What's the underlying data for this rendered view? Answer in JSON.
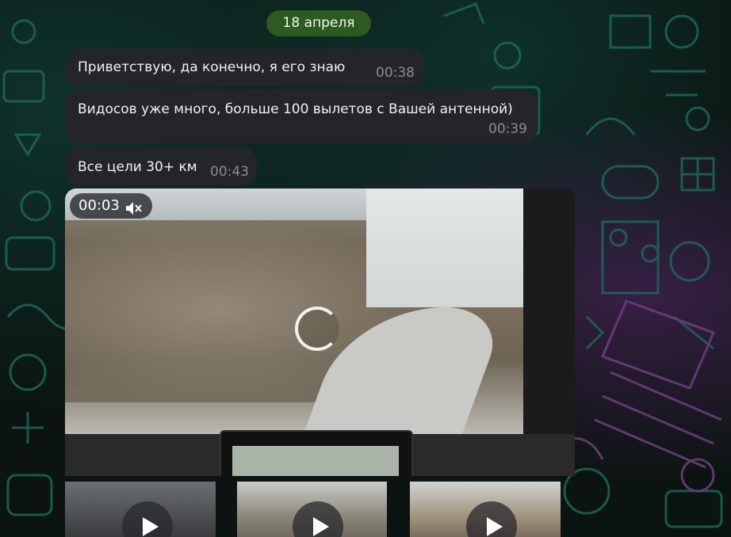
{
  "chat": {
    "date_badge": "18 апреля",
    "messages": [
      {
        "text": "Приветствую,  да конечно,  я его знаю",
        "time": "00:38"
      },
      {
        "text": "Видосов уже много, больше 100 вылетов с Вашей антенной)",
        "time": "00:39"
      },
      {
        "text": "Все цели 30+ км",
        "time": "00:43"
      }
    ],
    "video": {
      "duration": "00:03",
      "muted": true,
      "icons": {
        "mute": "muted-speaker-icon",
        "loading": "loading-spinner-icon"
      }
    },
    "thumbnails": [
      {
        "type": "video",
        "icon": "play-icon"
      },
      {
        "type": "video",
        "icon": "play-icon"
      },
      {
        "type": "video",
        "icon": "play-icon"
      }
    ]
  },
  "colors": {
    "wallpaper": "#0b1410",
    "bubble": "#232528",
    "date_badge": "#2d5a1f",
    "timestamp": "#8a8d92",
    "pattern_teal": "#1f6a5c",
    "pattern_purple": "#6a3d7a"
  }
}
